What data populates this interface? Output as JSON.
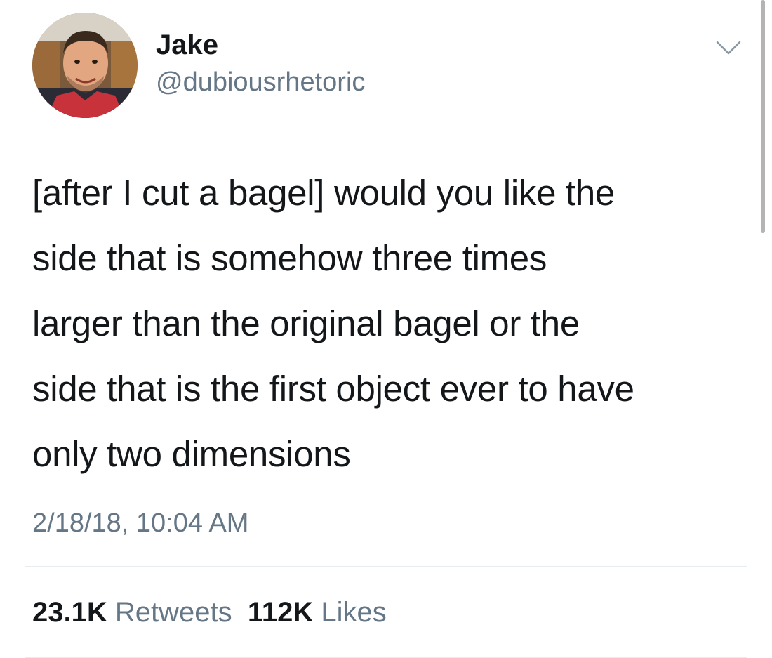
{
  "user": {
    "display_name": "Jake",
    "handle": "@dubiousrhetoric"
  },
  "tweet": {
    "lines": [
      "[after I cut a bagel] would you like the",
      "side that is somehow three times",
      "larger than the original bagel or the",
      "side that is the first object ever to have",
      "only two dimensions"
    ],
    "timestamp": "2/18/18, 10:04 AM"
  },
  "stats": {
    "retweets_count": "23.1K",
    "retweets_label": "Retweets",
    "likes_count": "112K",
    "likes_label": "Likes"
  },
  "icons": {
    "menu": "chevron-down-icon"
  },
  "colors": {
    "text": "#14171a",
    "secondary": "#657786",
    "divider": "#e6ecf0"
  }
}
